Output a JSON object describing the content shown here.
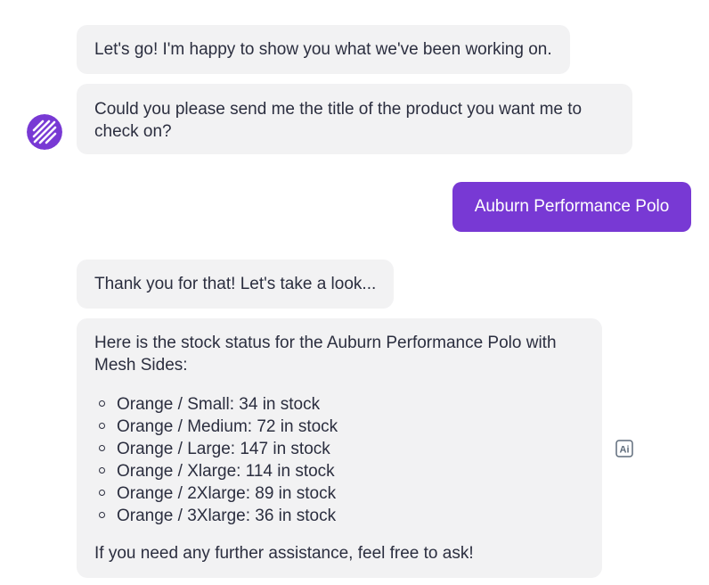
{
  "colors": {
    "accent": "#7839d4",
    "bot_bubble": "#f2f2f3",
    "text": "#2b2e3f"
  },
  "messages": {
    "greeting": "Let's go! I'm happy to show you what we've been working on.",
    "request_title": "Could you please send me the title of the product you want me to check on?",
    "user_reply": "Auburn Performance Polo",
    "thanks": "Thank you for that! Let's take a look...",
    "stock_intro": "Here is the stock status for the Auburn Performance Polo with Mesh Sides:",
    "stock_items": [
      "Orange / Small: 34 in stock",
      "Orange / Medium: 72 in stock",
      "Orange / Large: 147 in stock",
      "Orange / Xlarge: 114 in stock",
      "Orange / 2Xlarge: 89 in stock",
      "Orange / 3Xlarge: 36 in stock"
    ],
    "closing": "If you need any further assistance, feel free to ask!"
  },
  "icons": {
    "avatar": "bot-avatar-icon",
    "ai_badge": "ai-badge-icon",
    "ai_badge_text": "Ai"
  }
}
